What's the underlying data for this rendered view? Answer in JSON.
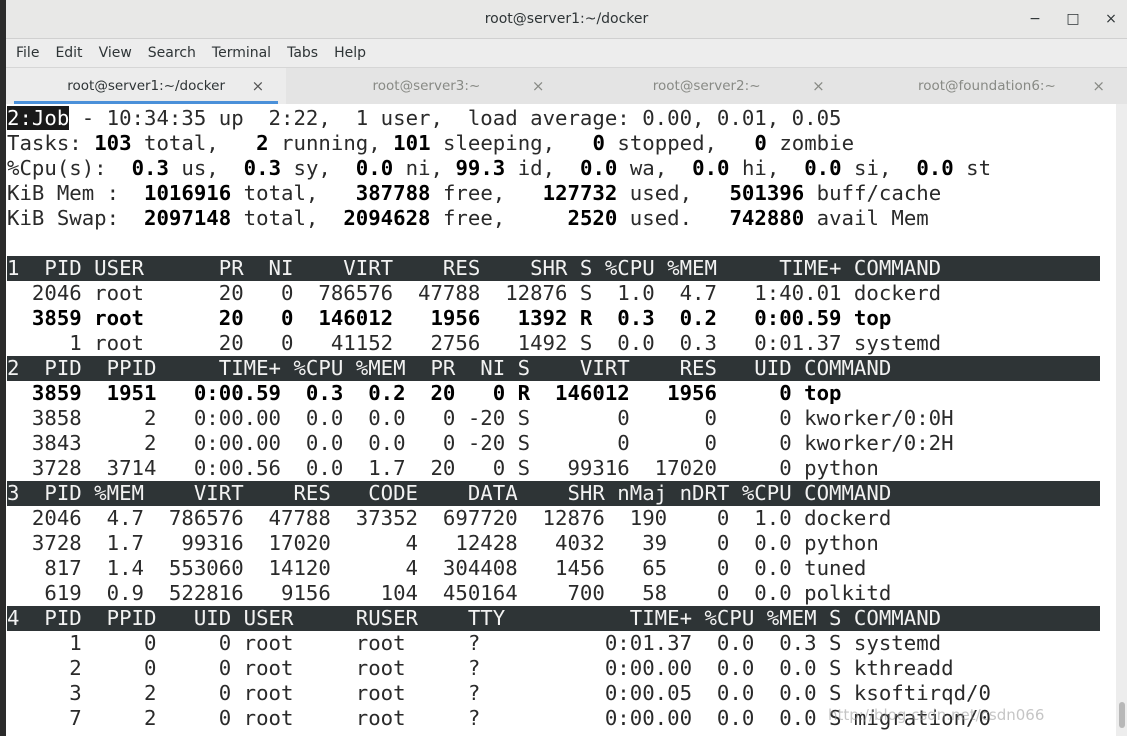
{
  "window": {
    "title": "root@server1:~/docker",
    "minimize_glyph": "−",
    "maximize_glyph": "□",
    "close_glyph": "×"
  },
  "menu": [
    "File",
    "Edit",
    "View",
    "Search",
    "Terminal",
    "Tabs",
    "Help"
  ],
  "tabs": [
    {
      "label": "root@server1:~/docker",
      "active": true
    },
    {
      "label": "root@server3:~",
      "active": false
    },
    {
      "label": "root@server2:~",
      "active": false
    },
    {
      "label": "root@foundation6:~",
      "active": false
    }
  ],
  "tab_close_glyph": "×",
  "summary": {
    "job": "2:Job",
    "uptime_rest": " - 10:34:35 up  2:22,  1 user,  load average: 0.00, 0.01, 0.05",
    "tasks": [
      "Tasks: ",
      "103",
      " total,   ",
      "2",
      " running, ",
      "101",
      " sleeping,   ",
      "0",
      " stopped,   ",
      "0",
      " zombie"
    ],
    "cpu": [
      "%Cpu(s):  ",
      "0.3",
      " us,  ",
      "0.3",
      " sy,  ",
      "0.0",
      " ni, ",
      "99.3",
      " id,  ",
      "0.0",
      " wa,  ",
      "0.0",
      " hi,  ",
      "0.0",
      " si,  ",
      "0.0",
      " st"
    ],
    "mem": [
      "KiB Mem :  ",
      "1016916",
      " total,   ",
      "387788",
      " free,   ",
      "127732",
      " used,   ",
      "501396",
      " buff/cache"
    ],
    "swap": [
      "KiB Swap:  ",
      "2097148",
      " total,  ",
      "2094628",
      " free,     ",
      "2520",
      " used.   ",
      "742880",
      " avail Mem"
    ]
  },
  "windows": [
    {
      "header": "1  PID USER      PR  NI    VIRT    RES    SHR S %CPU %MEM     TIME+ COMMAND",
      "rows": [
        {
          "text": "  2046 root      20   0  786576  47788  12876 S  1.0  4.7   1:40.01 dockerd",
          "bold": false
        },
        {
          "text": "  3859 root      20   0  146012   1956   1392 R  0.3  0.2   0:00.59 top",
          "bold": true
        },
        {
          "text": "     1 root      20   0   41152   2756   1492 S  0.0  0.3   0:01.37 systemd",
          "bold": false
        }
      ]
    },
    {
      "header": "2  PID  PPID     TIME+ %CPU %MEM  PR  NI S    VIRT    RES   UID COMMAND",
      "rows": [
        {
          "text": "  3859  1951   0:00.59  0.3  0.2  20   0 R  146012   1956     0 top",
          "bold": true
        },
        {
          "text": "  3858     2   0:00.00  0.0  0.0   0 -20 S       0      0     0 kworker/0:0H",
          "bold": false
        },
        {
          "text": "  3843     2   0:00.00  0.0  0.0   0 -20 S       0      0     0 kworker/0:2H",
          "bold": false
        },
        {
          "text": "  3728  3714   0:00.56  0.0  1.7  20   0 S   99316  17020     0 python",
          "bold": false
        }
      ]
    },
    {
      "header": "3  PID %MEM    VIRT    RES   CODE    DATA    SHR nMaj nDRT %CPU COMMAND",
      "rows": [
        {
          "text": "  2046  4.7  786576  47788  37352  697720  12876  190    0  1.0 dockerd",
          "bold": false
        },
        {
          "text": "  3728  1.7   99316  17020      4   12428   4032   39    0  0.0 python",
          "bold": false
        },
        {
          "text": "   817  1.4  553060  14120      4  304408   1456   65    0  0.0 tuned",
          "bold": false
        },
        {
          "text": "   619  0.9  522816   9156    104  450164    700   58    0  0.0 polkitd",
          "bold": false
        }
      ]
    },
    {
      "header": "4  PID  PPID   UID USER     RUSER    TTY          TIME+ %CPU %MEM S COMMAND",
      "rows": [
        {
          "text": "     1     0     0 root     root     ?          0:01.37  0.0  0.3 S systemd",
          "bold": false
        },
        {
          "text": "     2     0     0 root     root     ?          0:00.00  0.0  0.0 S kthreadd",
          "bold": false
        },
        {
          "text": "     3     2     0 root     root     ?          0:00.05  0.0  0.0 S ksoftirqd/0",
          "bold": false
        },
        {
          "text": "     7     2     0 root     root     ?          0:00.00  0.0  0.0 S migration/0",
          "bold": false
        }
      ]
    }
  ],
  "watermark": "http://blog.csdn.net/csdn066"
}
